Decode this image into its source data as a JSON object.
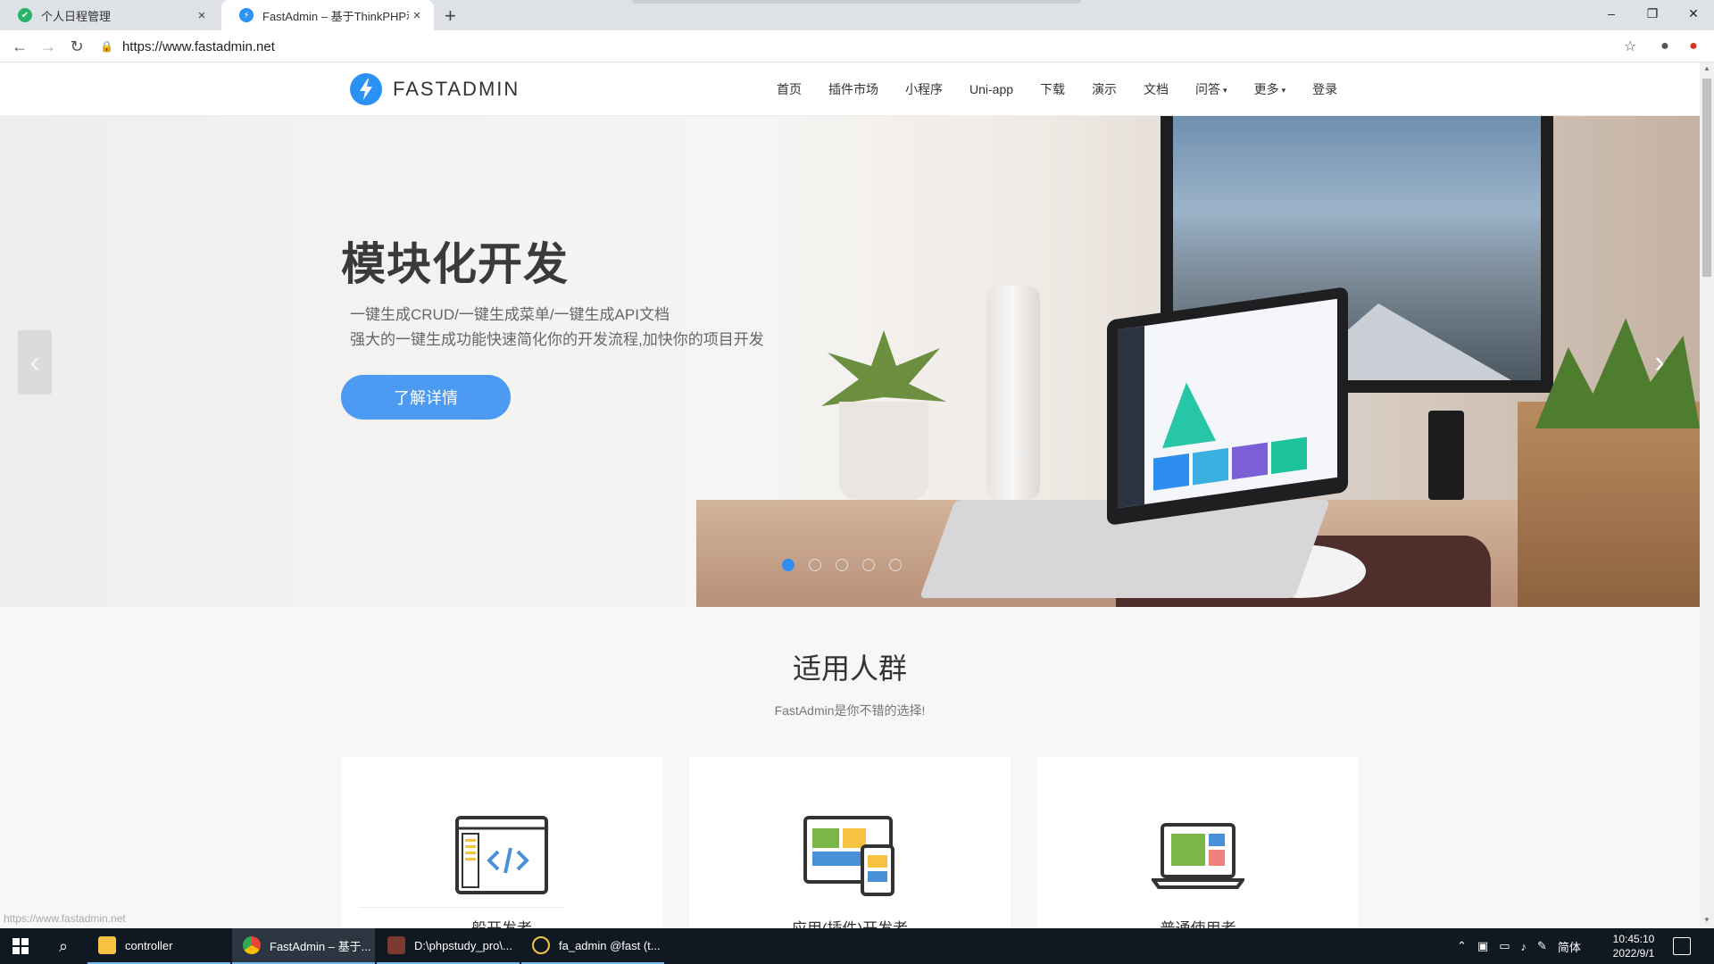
{
  "browser": {
    "tabs": [
      {
        "title": "个人日程管理",
        "close": "×"
      },
      {
        "title": "FastAdmin – 基于ThinkPHP和B",
        "close": "×"
      }
    ],
    "new_tab": "+",
    "window_controls": {
      "minimize": "–",
      "restore": "❐",
      "close": "✕"
    },
    "url": "https://www.fastadmin.net",
    "status_url": "https://www.fastadmin.net"
  },
  "site": {
    "logo_text": "FASTADMIN",
    "nav": [
      {
        "label": "首页"
      },
      {
        "label": "插件市场"
      },
      {
        "label": "小程序"
      },
      {
        "label": "Uni-app"
      },
      {
        "label": "下载"
      },
      {
        "label": "演示"
      },
      {
        "label": "文档"
      },
      {
        "label": "问答",
        "dropdown": true
      },
      {
        "label": "更多",
        "dropdown": true
      },
      {
        "label": "登录"
      }
    ],
    "caret": "▾"
  },
  "hero": {
    "title": "模块化开发",
    "line1": "一键生成CRUD/一键生成菜单/一键生成API文档",
    "line2": "强大的一键生成功能快速简化你的开发流程,加快你的项目开发",
    "button": "了解详情",
    "prev": "‹",
    "next": "›",
    "slides": 5,
    "active_slide": 1
  },
  "audience": {
    "title": "适用人群",
    "subtitle": "FastAdmin是你不错的选择!",
    "cards": [
      {
        "label": "般开发者",
        "icon": "code-window-icon"
      },
      {
        "label": "应用(插件)开发者",
        "icon": "devices-icon"
      },
      {
        "label": "普通使用者",
        "icon": "laptop-icon"
      }
    ]
  },
  "taskbar": {
    "apps": [
      {
        "label": "controller"
      },
      {
        "label": "FastAdmin – 基于..."
      },
      {
        "label": "D:\\phpstudy_pro\\..."
      },
      {
        "label": "fa_admin @fast (t..."
      }
    ],
    "ime": "简体",
    "time": "10:45:10",
    "date": "2022/9/1"
  },
  "colors": {
    "accent": "#2f8ff0",
    "button": "#4d9af3",
    "taskbar": "#101922"
  }
}
